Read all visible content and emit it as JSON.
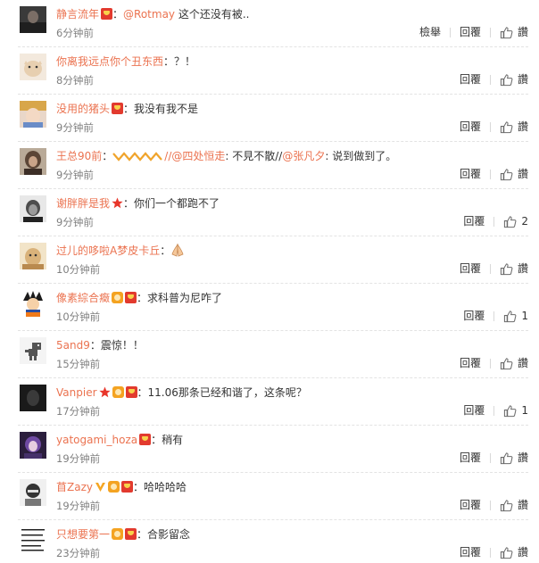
{
  "comments": [
    {
      "user": "静言流年",
      "text": "：",
      "mention": "@Rotmay",
      "tail": " 这个还没有被..",
      "time": "6分钟前",
      "report": "檢舉",
      "reply": "回覆",
      "like": "讚"
    },
    {
      "user": "你离我远点你个丑东西",
      "text": "：？！",
      "time": "8分钟前",
      "reply": "回覆",
      "like": "讚"
    },
    {
      "user": "没用的猪头",
      "text": "：我没有我不是",
      "time": "9分钟前",
      "reply": "回覆",
      "like": "讚"
    },
    {
      "user": "王总90前",
      "text": "：",
      "mention": "//@四处恒走",
      "mid": ": 不見不散//",
      "mention2": "@张凡夕",
      "tail": ": 说到做到了。",
      "time": "9分钟前",
      "reply": "回覆",
      "like": "讚"
    },
    {
      "user": "谢胖胖是我",
      "text": "：你们一个都跑不了",
      "time": "9分钟前",
      "reply": "回覆",
      "like": "2"
    },
    {
      "user": "过儿的哆啦A梦皮卡丘",
      "text": "：",
      "time": "10分钟前",
      "reply": "回覆",
      "like": "讚"
    },
    {
      "user": "像素綜合癥",
      "text": "：求科普为尼咋了",
      "time": "10分钟前",
      "reply": "回覆",
      "like": "1"
    },
    {
      "user": "5and9",
      "text": "：震惊！！",
      "time": "15分钟前",
      "reply": "回覆",
      "like": "讚"
    },
    {
      "user": "Vanpier",
      "text": "：11.06那条已经和谐了，这条呢？",
      "time": "17分钟前",
      "reply": "回覆",
      "like": "1"
    },
    {
      "user": "yatogami_hoza",
      "text": "：稍有",
      "time": "19分钟前",
      "reply": "回覆",
      "like": "讚"
    },
    {
      "user": "苜Zazy",
      "text": "：哈哈哈哈",
      "time": "19分钟前",
      "reply": "回覆",
      "like": "讚"
    },
    {
      "user": "只想要第一",
      "text": "：合影留念",
      "time": "23分钟前",
      "reply": "回覆",
      "like": "讚"
    }
  ],
  "avatar_texts": {
    "last": "我个没有\n没有智慧\n没没有\n没有智慧"
  }
}
